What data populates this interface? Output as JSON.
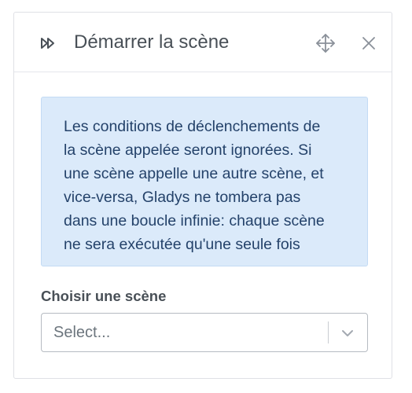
{
  "header": {
    "icon": "fast-forward-icon",
    "title": "Démarrer la scène",
    "move_icon": "move-icon",
    "close_icon": "close-icon"
  },
  "alert": {
    "lines": [
      "Les conditions de déclenchements de",
      "la scène appelée seront ignorées. Si",
      "une scène appelle une autre scène, et",
      "vice-versa, Gladys ne tombera pas",
      "dans une boucle infinie: chaque scène",
      "ne sera exécutée qu'une seule fois"
    ]
  },
  "field": {
    "label": "Choisir une scène",
    "placeholder": "Select...",
    "chevron_icon": "chevron-down-icon"
  },
  "colors": {
    "alert_background": "#dbeafa",
    "alert_text": "#24426a"
  }
}
